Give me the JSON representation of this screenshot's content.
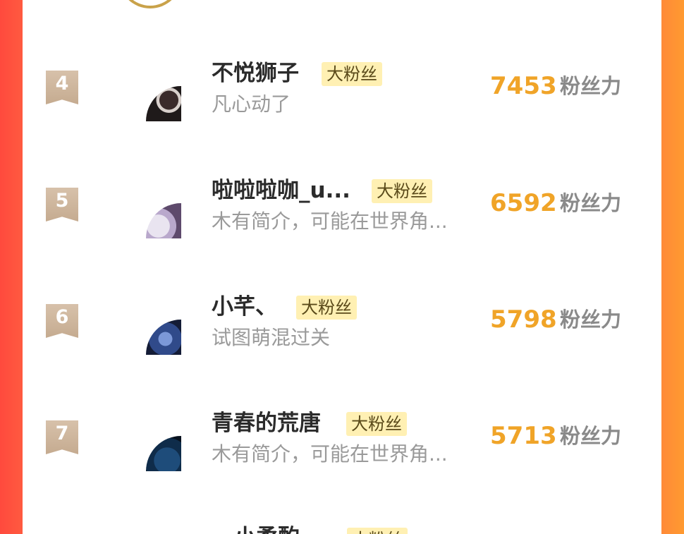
{
  "colors": {
    "rank_bg": "#d0b79d",
    "score": "#f0a428",
    "badge_bg": "#fff0b3",
    "name": "#2b2b2b",
    "bio": "#9a9a9a",
    "unit": "#8a8a8a",
    "side_left": "#ff4a3d",
    "side_right": "#ff9a30"
  },
  "rows": [
    {
      "rank": "4",
      "name": "不悦狮子",
      "badge": "大粉丝",
      "bio": "凡心动了",
      "score": "7453",
      "unit": "粉丝力"
    },
    {
      "rank": "5",
      "name": "啦啦啦咖_u...",
      "badge": "大粉丝",
      "bio": "木有简介，可能在世界角...",
      "score": "6592",
      "unit": "粉丝力"
    },
    {
      "rank": "6",
      "name": "小芊、",
      "badge": "大粉丝",
      "bio": "试图萌混过关",
      "score": "5798",
      "unit": "粉丝力"
    },
    {
      "rank": "7",
      "name": "青春的荒唐",
      "badge": "大粉丝",
      "bio": "木有简介，可能在世界角...",
      "score": "5713",
      "unit": "粉丝力"
    }
  ],
  "partial_row": {
    "name": "小柔酌",
    "badge": "大粉丝"
  }
}
